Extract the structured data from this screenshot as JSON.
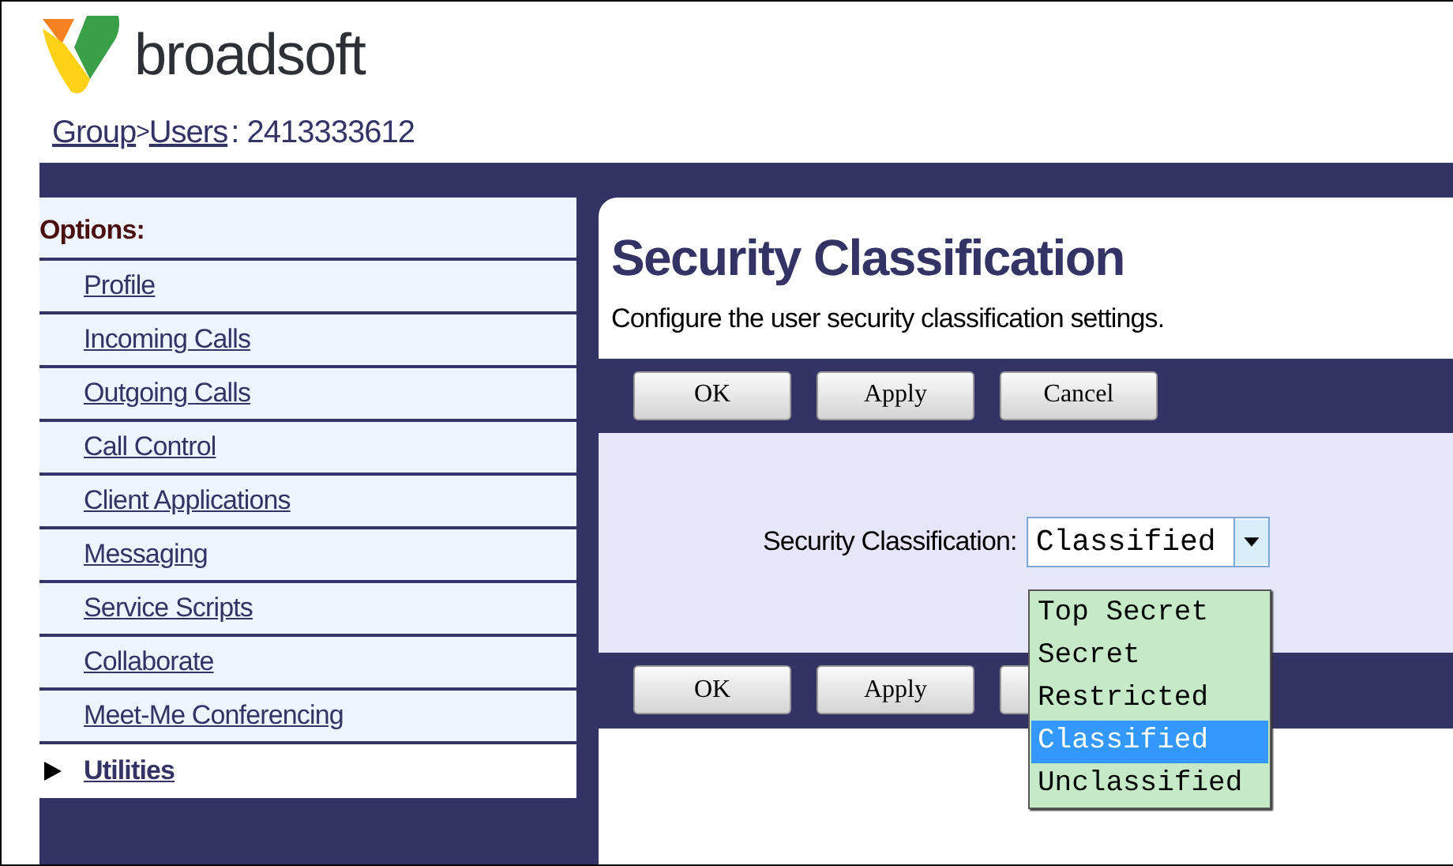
{
  "logo": {
    "text": "broadsoft"
  },
  "breadcrumb": {
    "links": [
      "Group",
      "Users"
    ],
    "separator": ">",
    "suffix": ": 2413333612"
  },
  "sidebar": {
    "header": "Options:",
    "items": [
      {
        "label": "Profile",
        "selected": false
      },
      {
        "label": "Incoming Calls",
        "selected": false
      },
      {
        "label": "Outgoing Calls",
        "selected": false
      },
      {
        "label": "Call Control",
        "selected": false
      },
      {
        "label": "Client Applications",
        "selected": false
      },
      {
        "label": "Messaging",
        "selected": false
      },
      {
        "label": "Service Scripts",
        "selected": false
      },
      {
        "label": "Collaborate",
        "selected": false
      },
      {
        "label": "Meet-Me Conferencing",
        "selected": false
      },
      {
        "label": "Utilities",
        "selected": true
      }
    ]
  },
  "page": {
    "title": "Security Classification",
    "description": "Configure the user security classification settings."
  },
  "top_buttons": [
    "OK",
    "Apply",
    "Cancel"
  ],
  "form": {
    "label": "Security Classification:",
    "value": "Classified",
    "expanded": true,
    "options": [
      {
        "label": "Top Secret",
        "selected": false
      },
      {
        "label": "Secret",
        "selected": false
      },
      {
        "label": "Restricted",
        "selected": false
      },
      {
        "label": "Classified",
        "selected": true
      },
      {
        "label": "Unclassified",
        "selected": false
      }
    ]
  },
  "bottom_buttons": [
    "OK",
    "Apply"
  ],
  "bottom_covered_button": true
}
